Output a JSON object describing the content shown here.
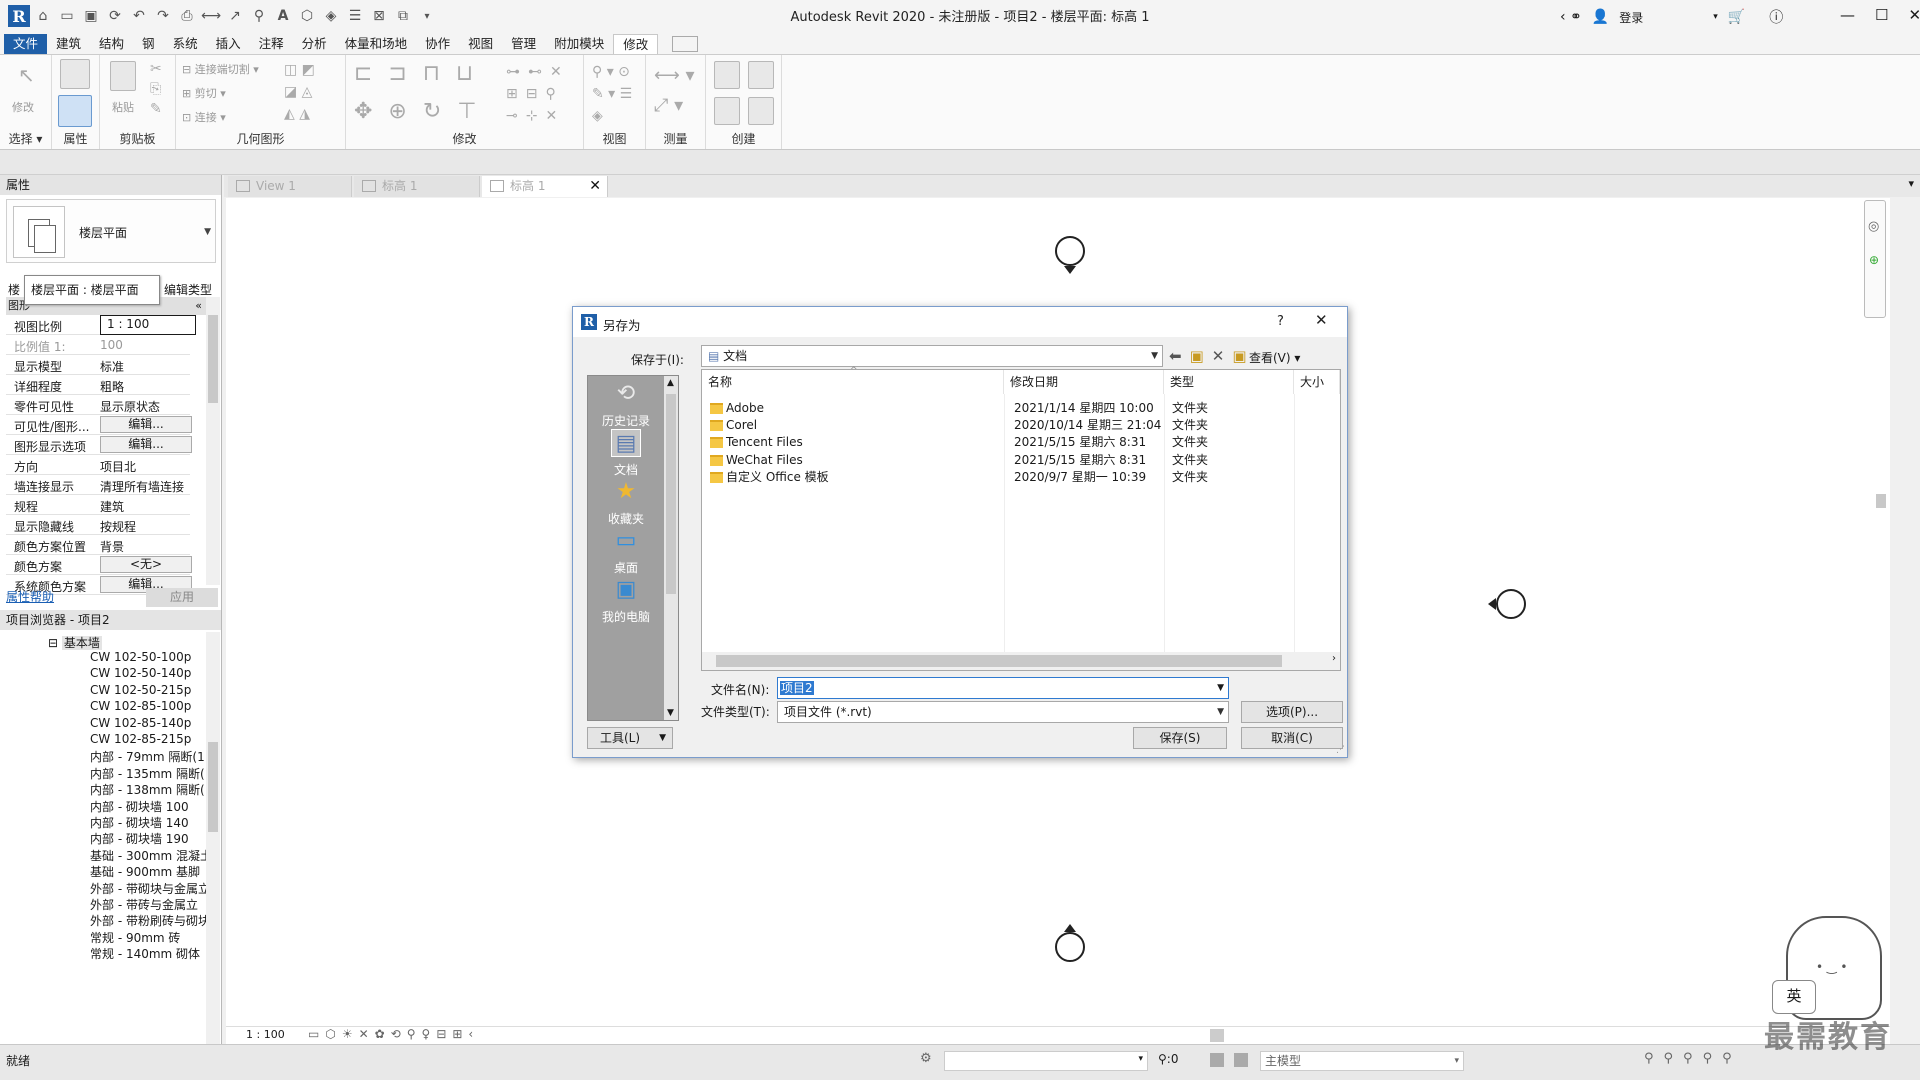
{
  "window": {
    "title": "Autodesk Revit 2020 - 未注册版 - 项目2 - 楼层平面: 标高 1",
    "login_label": "登录"
  },
  "menu": {
    "tabs": [
      "文件",
      "建筑",
      "结构",
      "钢",
      "系统",
      "插入",
      "注释",
      "分析",
      "体量和场地",
      "协作",
      "视图",
      "管理",
      "附加模块",
      "修改"
    ],
    "active": "修改"
  },
  "ribbon": {
    "select_label": "选择",
    "modify_label": "修改",
    "properties_label": "属性",
    "clipboard_label": "剪贴板",
    "paste_label": "粘贴",
    "geometry_label": "几何图形",
    "cut_join_label": "连接端切割",
    "cut_label": "剪切",
    "join_label": "连接",
    "modify_panel_label": "修改",
    "view_label": "视图",
    "measure_label": "测量",
    "create_label": "创建"
  },
  "properties": {
    "header": "属性",
    "type_name": "楼层平面",
    "tooltip": "楼层平面 : 楼层平面",
    "edit_type": "编辑类型",
    "tab_label": "楼",
    "group_header": "图形",
    "rows": [
      {
        "key": "视图比例",
        "value": "1 : 100",
        "kind": "input"
      },
      {
        "key": "比例值 1:",
        "value": "100",
        "kind": "gray"
      },
      {
        "key": "显示模型",
        "value": "标准",
        "kind": "text"
      },
      {
        "key": "详细程度",
        "value": "粗略",
        "kind": "text"
      },
      {
        "key": "零件可见性",
        "value": "显示原状态",
        "kind": "text"
      },
      {
        "key": "可见性/图形...",
        "value": "编辑...",
        "kind": "button"
      },
      {
        "key": "图形显示选项",
        "value": "编辑...",
        "kind": "button"
      },
      {
        "key": "方向",
        "value": "项目北",
        "kind": "text"
      },
      {
        "key": "墙连接显示",
        "value": "清理所有墙连接",
        "kind": "text"
      },
      {
        "key": "规程",
        "value": "建筑",
        "kind": "text"
      },
      {
        "key": "显示隐藏线",
        "value": "按规程",
        "kind": "text"
      },
      {
        "key": "颜色方案位置",
        "value": "背景",
        "kind": "text"
      },
      {
        "key": "颜色方案",
        "value": "<无>",
        "kind": "button"
      },
      {
        "key": "系统颜色方案",
        "value": "编辑...",
        "kind": "button"
      }
    ],
    "help_link": "属性帮助",
    "apply_button": "应用"
  },
  "browser": {
    "header": "项目浏览器 - 项目2",
    "group": "基本墙",
    "items": [
      "CW 102-50-100p",
      "CW 102-50-140p",
      "CW 102-50-215p",
      "CW 102-85-100p",
      "CW 102-85-140p",
      "CW 102-85-215p",
      "内部 - 79mm 隔断(1",
      "内部 - 135mm 隔断(",
      "内部 - 138mm 隔断(",
      "内部 - 砌块墙 100",
      "内部 - 砌块墙 140",
      "内部 - 砌块墙 190",
      "基础 - 300mm 混凝土",
      "基础 - 900mm 基脚",
      "外部 - 带砌块与金属立",
      "外部 - 带砖与金属立",
      "外部 - 带粉刷砖与砌块",
      "常规 - 90mm 砖",
      "常规 - 140mm 砌体"
    ]
  },
  "doc_tabs": [
    "View 1",
    "标高 1",
    "标高 1"
  ],
  "viewbar": {
    "scale": "1 : 100"
  },
  "status": {
    "left_text": "就绪",
    "filter_value": ":0",
    "model_label": "主模型"
  },
  "dialog": {
    "title": "另存为",
    "help": "?",
    "save_in_label": "保存于(I):",
    "save_in_value": "文档",
    "view_menu": "查看(V)",
    "places": [
      "历史记录",
      "文档",
      "收藏夹",
      "桌面",
      "我的电脑"
    ],
    "columns": [
      "名称",
      "修改日期",
      "类型",
      "大小"
    ],
    "files": [
      {
        "name": "Adobe",
        "date": "2021/1/14 星期四 10:00",
        "type": "文件夹"
      },
      {
        "name": "Corel",
        "date": "2020/10/14 星期三 21:04",
        "type": "文件夹"
      },
      {
        "name": "Tencent Files",
        "date": "2021/5/15 星期六 8:31",
        "type": "文件夹"
      },
      {
        "name": "WeChat Files",
        "date": "2021/5/15 星期六 8:31",
        "type": "文件夹"
      },
      {
        "name": "自定义 Office 模板",
        "date": "2020/9/7 星期一 10:39",
        "type": "文件夹"
      }
    ],
    "filename_label": "文件名(N):",
    "filename_value": "项目2",
    "filetype_label": "文件类型(T):",
    "filetype_value": "项目文件 (*.rvt)",
    "options_button": "选项(P)...",
    "tools_button": "工具(L)",
    "save_button": "保存(S)",
    "cancel_button": "取消(C)"
  },
  "watermark": {
    "badge": "英",
    "text": "最需教育"
  }
}
